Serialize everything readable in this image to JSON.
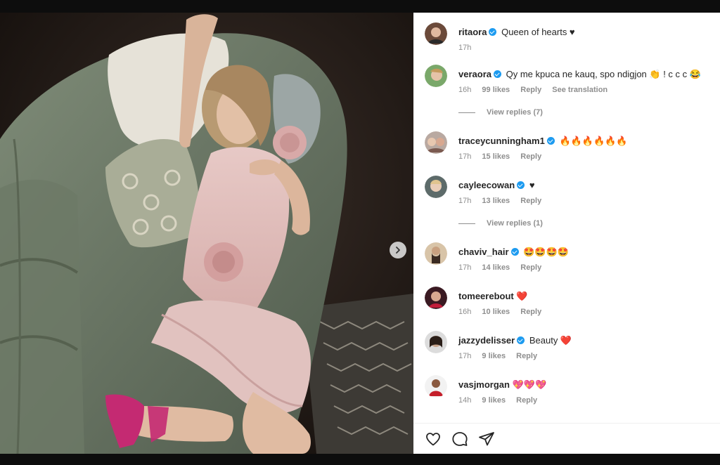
{
  "post": {
    "caption": {
      "username": "ritaora",
      "verified": true,
      "text": "Queen of hearts ♥",
      "time": "17h"
    },
    "comments": [
      {
        "username": "veraora",
        "verified": true,
        "text": "Qy me kpuca ne kauq, spo ndigjon 👏 ! c c c 😂",
        "time": "16h",
        "likes": "99 likes",
        "reply": "Reply",
        "translate": "See translation",
        "replies": "View replies (7)"
      },
      {
        "username": "traceycunningham1",
        "verified": true,
        "text": "🔥🔥🔥🔥🔥🔥",
        "time": "17h",
        "likes": "15 likes",
        "reply": "Reply"
      },
      {
        "username": "cayleecowan",
        "verified": true,
        "text": "♥",
        "time": "17h",
        "likes": "13 likes",
        "reply": "Reply",
        "replies": "View replies (1)"
      },
      {
        "username": "chaviv_hair",
        "verified": true,
        "text": "🤩🤩🤩🤩",
        "time": "17h",
        "likes": "14 likes",
        "reply": "Reply"
      },
      {
        "username": "tomeerebout",
        "verified": false,
        "text": "❤️",
        "time": "16h",
        "likes": "10 likes",
        "reply": "Reply"
      },
      {
        "username": "jazzydelisser",
        "verified": true,
        "text": "Beauty ❤️",
        "time": "17h",
        "likes": "9 likes",
        "reply": "Reply"
      },
      {
        "username": "vasjmorgan",
        "verified": false,
        "text": "💖💖💖",
        "time": "14h",
        "likes": "9 likes",
        "reply": "Reply"
      }
    ]
  },
  "icons": {
    "next": "chevron-right-icon",
    "like": "heart-icon",
    "comment": "comment-bubble-icon",
    "share": "paper-plane-icon"
  },
  "colors": {
    "verified": "#1d9bf0",
    "text": "#262626",
    "muted": "#8e8e8e"
  }
}
